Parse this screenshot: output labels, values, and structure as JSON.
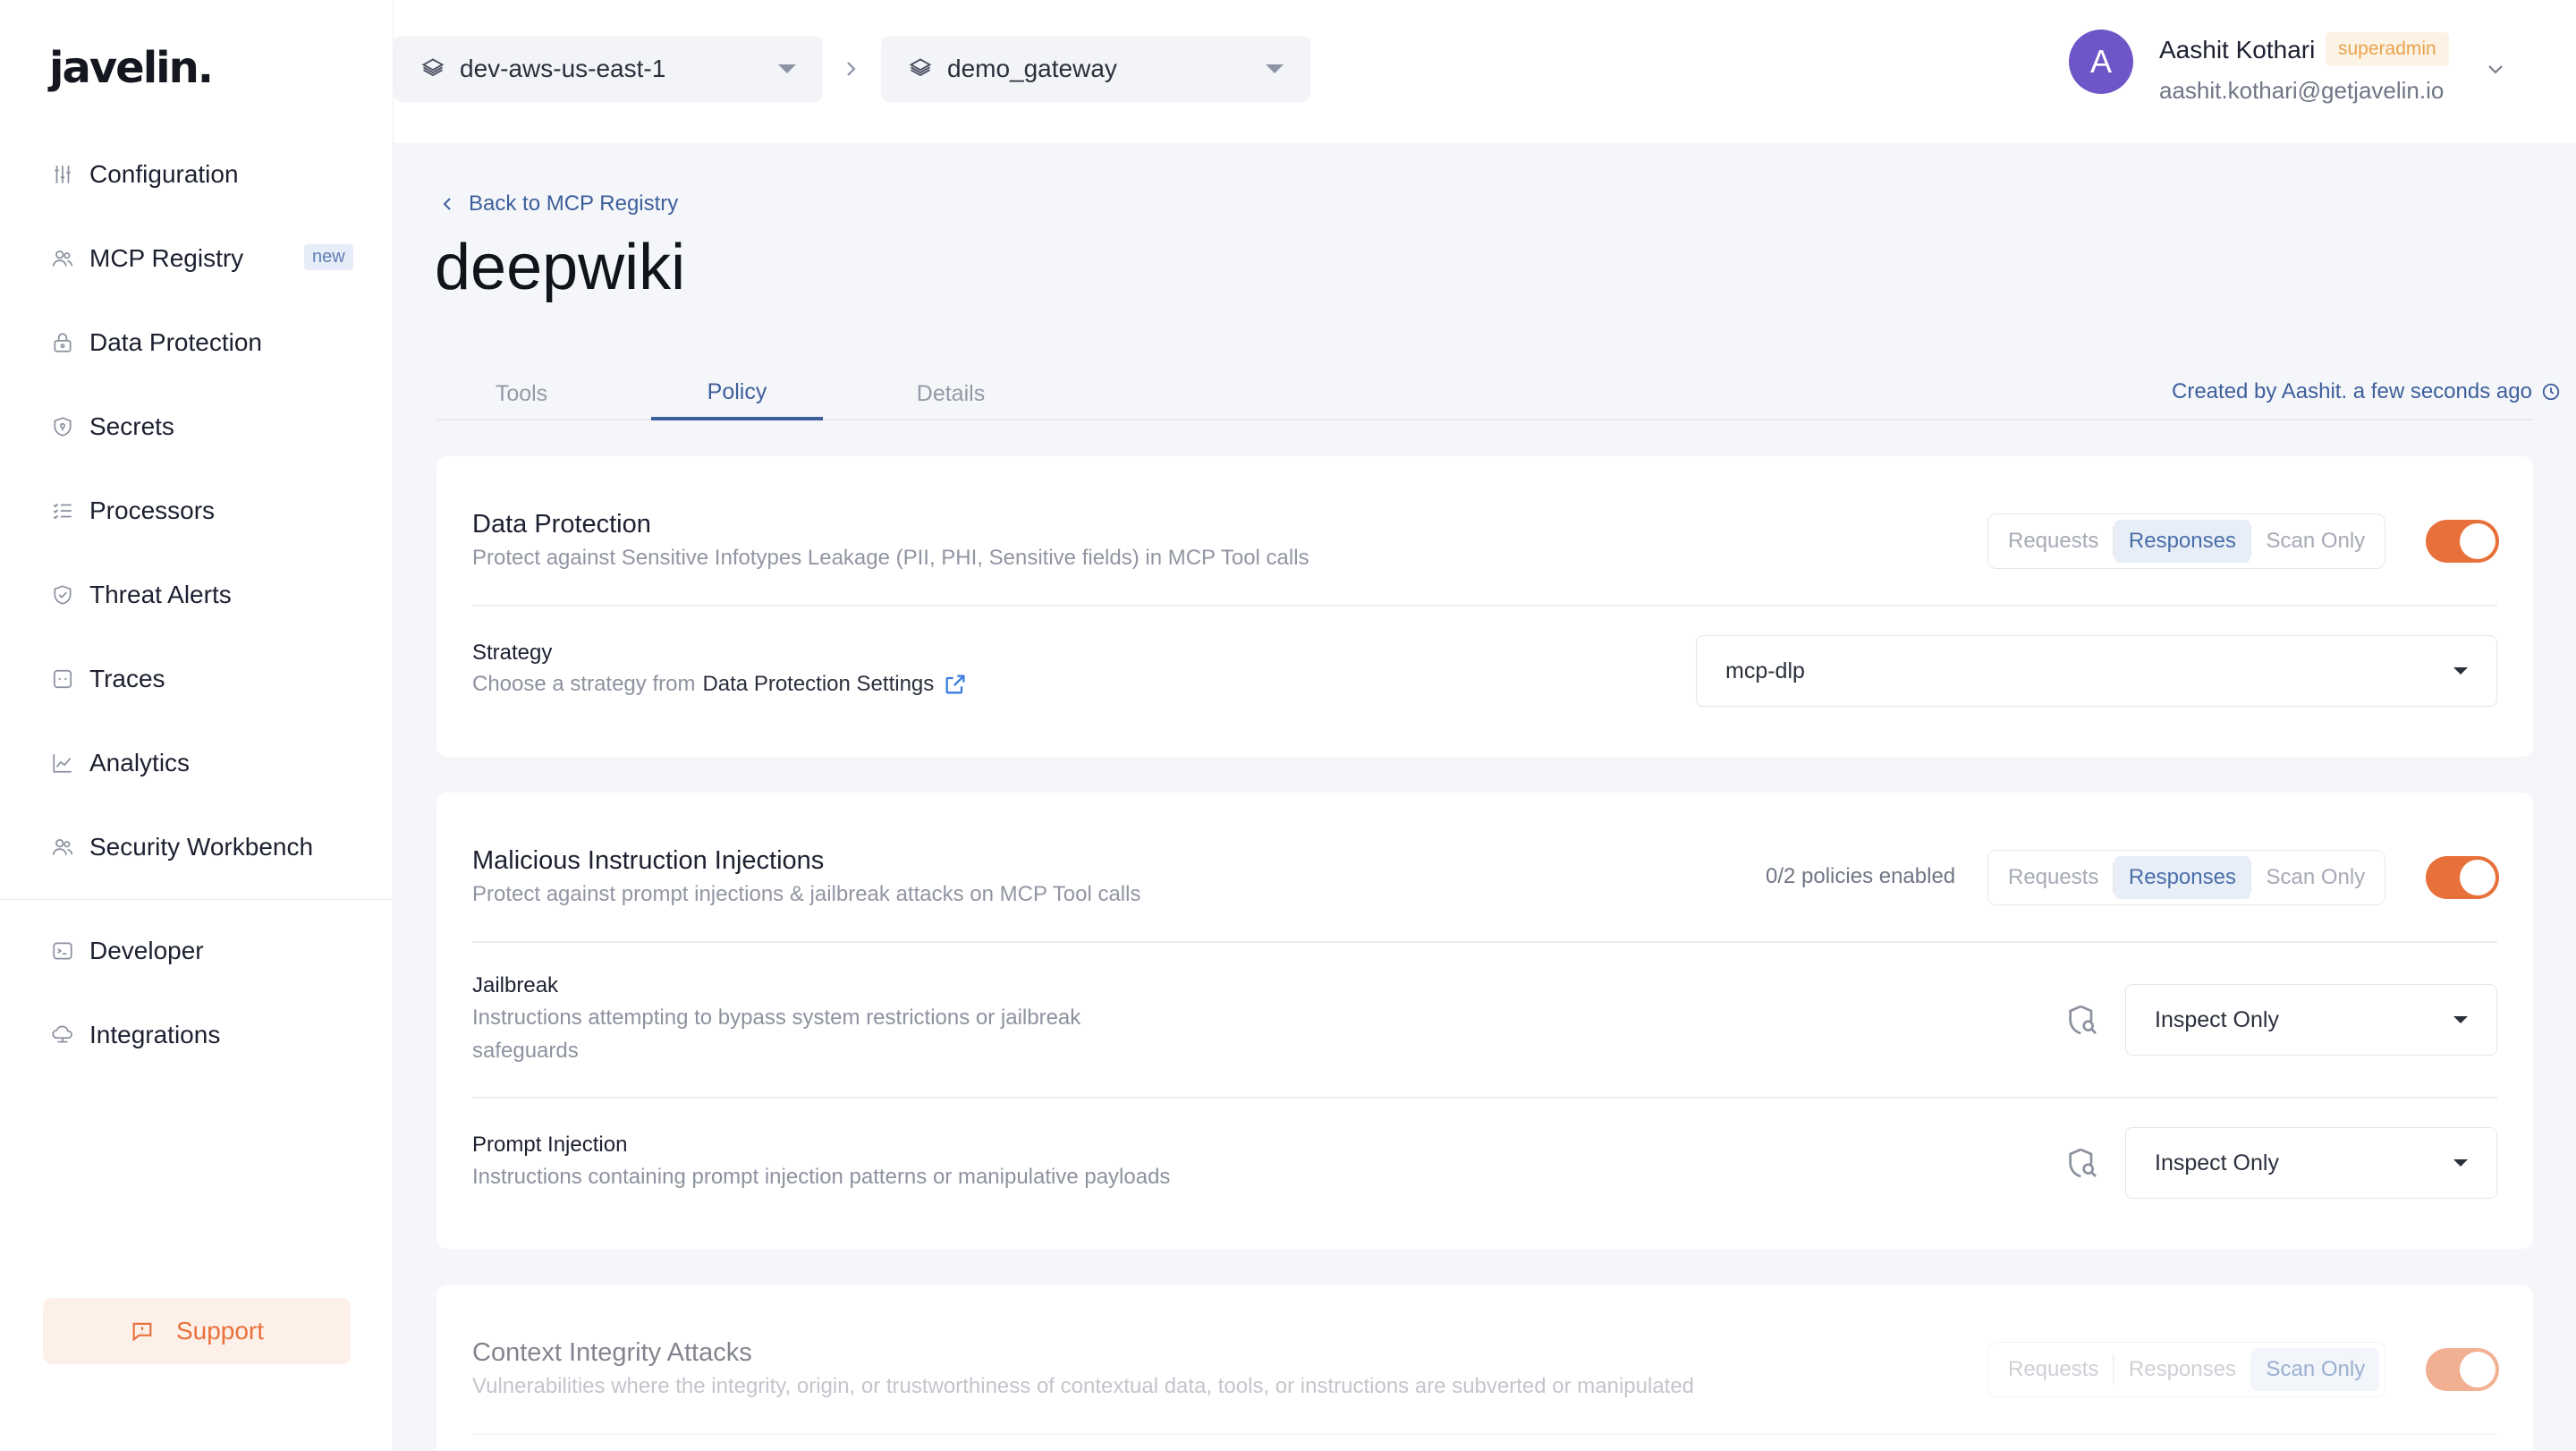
{
  "brand": {
    "logo": "javelin."
  },
  "sidebar": {
    "items": [
      {
        "label": "Configuration",
        "icon": "sliders-icon"
      },
      {
        "label": "MCP Registry",
        "icon": "users-icon",
        "badge": "new"
      },
      {
        "label": "Data Protection",
        "icon": "lock-icon"
      },
      {
        "label": "Secrets",
        "icon": "shield-key-icon"
      },
      {
        "label": "Processors",
        "icon": "list-check-icon"
      },
      {
        "label": "Threat Alerts",
        "icon": "shield-check-icon"
      },
      {
        "label": "Traces",
        "icon": "square-dashed-icon"
      },
      {
        "label": "Analytics",
        "icon": "line-chart-icon"
      },
      {
        "label": "Security Workbench",
        "icon": "users-icon"
      },
      {
        "label": "Developer",
        "icon": "terminal-icon"
      },
      {
        "label": "Integrations",
        "icon": "cloud-network-icon"
      }
    ],
    "support_label": "Support"
  },
  "topbar": {
    "environment": "dev-aws-us-east-1",
    "gateway": "demo_gateway",
    "user": {
      "initial": "A",
      "name": "Aashit Kothari",
      "role": "superadmin",
      "email": "aashit.kothari@getjavelin.io"
    }
  },
  "page": {
    "back_label": "Back to MCP Registry",
    "title": "deepwiki",
    "tabs": [
      {
        "label": "Tools",
        "active": false
      },
      {
        "label": "Policy",
        "active": true
      },
      {
        "label": "Details",
        "active": false
      }
    ],
    "created_by": "Created by Aashit. a few seconds ago"
  },
  "sections": {
    "data_protection": {
      "title": "Data Protection",
      "description": "Protect against Sensitive Infotypes Leakage (PII, PHI, Sensitive fields) in MCP Tool calls",
      "scope_options": [
        "Requests",
        "Responses",
        "Scan Only"
      ],
      "scope_selected": "Responses",
      "enabled": true,
      "strategy": {
        "title": "Strategy",
        "desc_prefix": "Choose a strategy from",
        "link_text": "Data Protection Settings",
        "value": "mcp-dlp"
      }
    },
    "malicious_injections": {
      "title": "Malicious Instruction Injections",
      "description": "Protect against prompt injections & jailbreak attacks on MCP Tool calls",
      "policies_enabled": "0/2 policies enabled",
      "scope_options": [
        "Requests",
        "Responses",
        "Scan Only"
      ],
      "scope_selected": "Responses",
      "enabled": true,
      "rows": [
        {
          "title": "Jailbreak",
          "description_line1": "Instructions attempting to bypass system restrictions or jailbreak",
          "description_line2": "safeguards",
          "action": "Inspect Only"
        },
        {
          "title": "Prompt Injection",
          "description_line1": "Instructions containing prompt injection patterns or manipulative payloads",
          "action": "Inspect Only"
        }
      ]
    },
    "context_integrity": {
      "title": "Context Integrity Attacks",
      "description": "Vulnerabilities where the integrity, origin, or trustworthiness of contextual data, tools, or instructions are subverted or manipulated",
      "scope_options": [
        "Requests",
        "Responses",
        "Scan Only"
      ],
      "scope_selected": "Scan Only",
      "enabled": true
    }
  },
  "colors": {
    "accent": "#e8703a",
    "link": "#3e5f9c",
    "avatar": "#6e56c8"
  }
}
